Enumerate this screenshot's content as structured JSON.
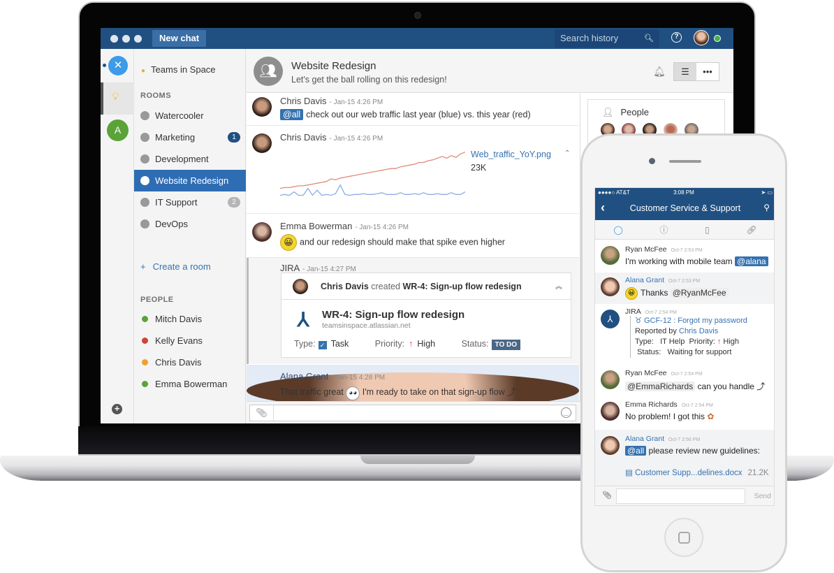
{
  "topbar": {
    "new_chat_label": "New chat",
    "search_placeholder": "Search history",
    "help_icon": "?"
  },
  "rail": {
    "team_avatar_letter": "A"
  },
  "sidebar": {
    "team_name": "Teams in Space",
    "rooms_heading": "ROOMS",
    "rooms": [
      {
        "label": "Watercooler",
        "badge": ""
      },
      {
        "label": "Marketing",
        "badge": "1"
      },
      {
        "label": "Development",
        "badge": ""
      },
      {
        "label": "Website Redesign",
        "badge": "",
        "active": true
      },
      {
        "label": "IT Support",
        "badge": "2"
      },
      {
        "label": "DevOps",
        "badge": ""
      }
    ],
    "create_room_label": "Create a room",
    "people_heading": "PEOPLE",
    "people": [
      {
        "name": "Mitch Davis",
        "status": "online",
        "color": "#5aa338"
      },
      {
        "name": "Kelly Evans",
        "status": "do-not-disturb",
        "color": "#d04437"
      },
      {
        "name": "Chris Davis",
        "status": "away",
        "color": "#f0a02b"
      },
      {
        "name": "Emma Bowerman",
        "status": "online",
        "color": "#5aa338"
      }
    ]
  },
  "room": {
    "title": "Website Redesign",
    "topic": "Let's get the ball rolling on this redesign!"
  },
  "messages": [
    {
      "author": "Chris Davis",
      "time": "- Jan-15 4:26 PM",
      "mention": "@all",
      "text": "check out our web traffic last year (blue) vs. this year (red)"
    },
    {
      "author": "Chris Davis",
      "time": "- Jan-15 4:26 PM",
      "file_name": "Web_traffic_YoY.png",
      "file_size": "23K"
    },
    {
      "author": "Emma Bowerman",
      "time": "- Jan-15 4:26 PM",
      "text": "and our redesign should make that spike even higher"
    },
    {
      "author": "JIRA",
      "time": "- Jan-15 4:27 PM"
    },
    {
      "author": "Alana Grant",
      "time": "- Jan-15 4:28 PM",
      "text_before": "That traffic great",
      "text_after": "I'm ready to take on that sign-up flow"
    }
  ],
  "jira_card": {
    "actor": "Chris Davis",
    "action": "created",
    "issue_ref": "WR-4: Sign-up flow redesign",
    "title": "WR-4: Sign-up flow redesign",
    "url": "teamsinspace.atlassian.net",
    "type_label": "Type:",
    "type_value": "Task",
    "priority_label": "Priority:",
    "priority_value": "High",
    "status_label": "Status:",
    "status_value": "TO DO"
  },
  "people_panel": {
    "heading": "People"
  },
  "traffic_preview": {
    "this_year_red": [
      10,
      11,
      11,
      12,
      13,
      13,
      14,
      15,
      16,
      17,
      18,
      21,
      20,
      22,
      23,
      24,
      25,
      26,
      27,
      28,
      29,
      30,
      31,
      32,
      33,
      33,
      35,
      36,
      37,
      38,
      40,
      40,
      42,
      43,
      45,
      47,
      45,
      48,
      46,
      50,
      52
    ],
    "last_year_blue": [
      2,
      3,
      2,
      6,
      2,
      2,
      10,
      2,
      8,
      2,
      3,
      2,
      4,
      14,
      3,
      2,
      3,
      3,
      4,
      3,
      3,
      4,
      5,
      3,
      3,
      3,
      5,
      3,
      3,
      4,
      3,
      5,
      3,
      3,
      4,
      3,
      3,
      5,
      3,
      3,
      6
    ]
  },
  "phone": {
    "carrier": "●●●●○ AT&T",
    "time": "3:08 PM",
    "title": "Customer Service & Support",
    "messages": [
      {
        "author": "Ryan McFee",
        "time": "Oct-7 2:53 PM",
        "text": "I'm working with mobile team",
        "mention": "@alana"
      },
      {
        "author": "Alana Grant",
        "time": "Oct-7 2:53 PM",
        "text": "Thanks",
        "mention": "@RyanMcFee"
      },
      {
        "author": "JIRA",
        "time": "Oct-7 2:54 PM",
        "issue": "GCF-12 : Forgot my password",
        "reported_by_label": "Reported by",
        "reporter": "Chris Davis",
        "type_label": "Type:",
        "type_value": "IT Help",
        "priority_label": "Priority:",
        "priority_value": "High",
        "status_label": "Status:",
        "status_value": "Waiting for support"
      },
      {
        "author": "Ryan McFee",
        "time": "Oct-7 2:54 PM",
        "mention": "@EmmaRichards",
        "text": "can you handle"
      },
      {
        "author": "Emma Richards",
        "time": "Oct-7 2:54 PM",
        "text": "No problem! I got this"
      },
      {
        "author": "Alana Grant",
        "time": "Oct-7 2:56 PM",
        "mention": "@all",
        "text": "please review new guidelines:",
        "file_name": "Customer Supp...delines.docx",
        "file_size": "21.2K"
      }
    ],
    "send_label": "Send"
  }
}
